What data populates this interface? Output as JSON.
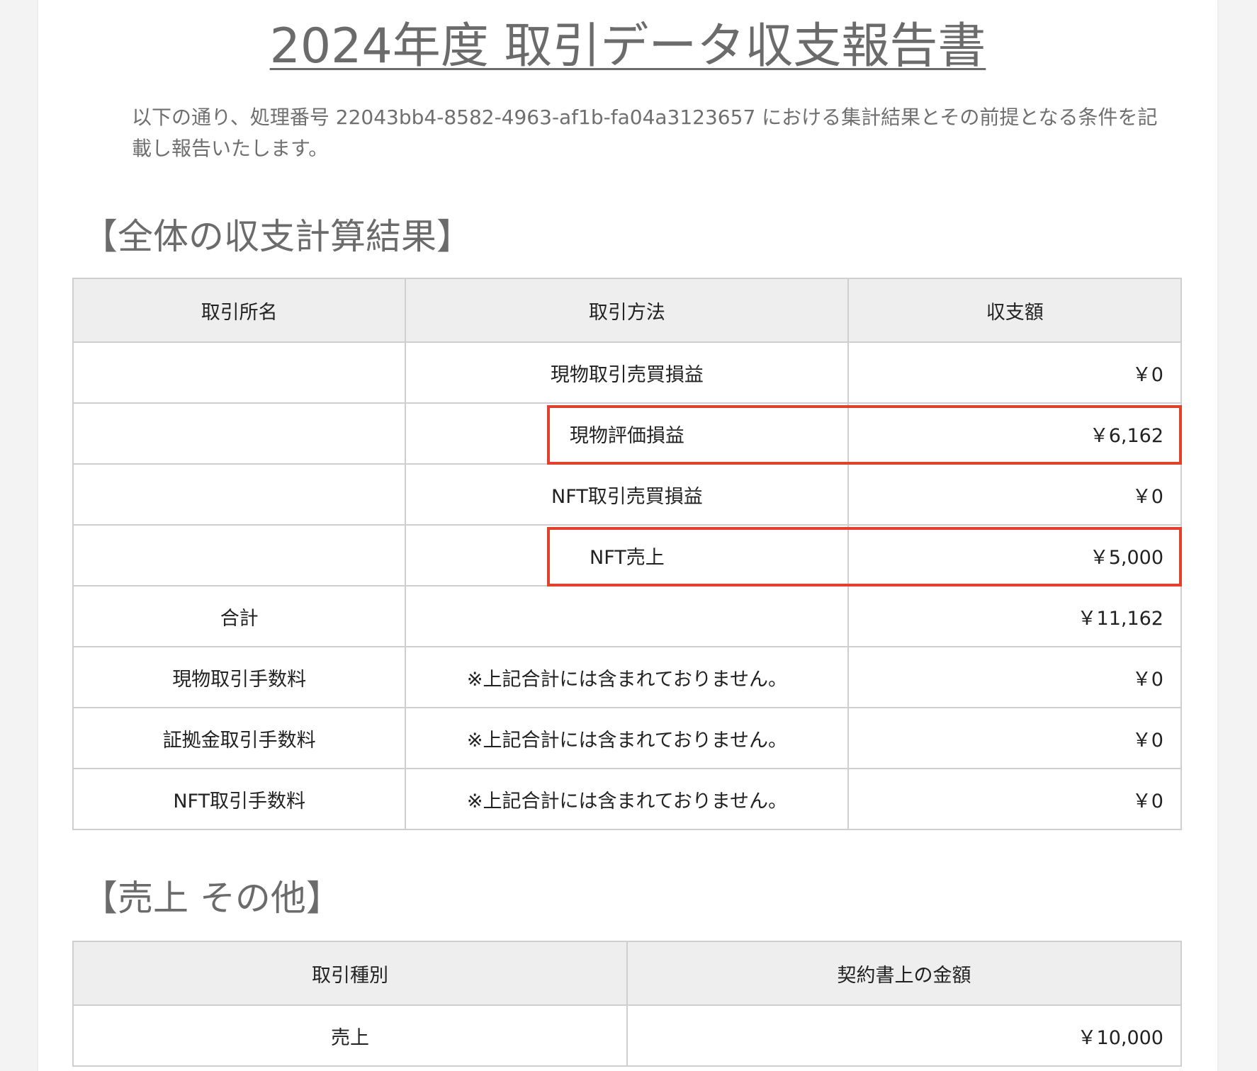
{
  "document": {
    "title": "2024年度 取引データ収支報告書",
    "intro": "以下の通り、処理番号 22043bb4-8582-4963-af1b-fa04a3123657 における集計結果とその前提となる条件を記載し報告いたします。"
  },
  "section1": {
    "heading": "【全体の収支計算結果】",
    "headers": [
      "取引所名",
      "取引方法",
      "収支額"
    ],
    "rows": [
      {
        "exchange": "",
        "method": "現物取引売買損益",
        "amount": "￥0"
      },
      {
        "exchange": "",
        "method": "現物評価損益",
        "amount": "￥6,162"
      },
      {
        "exchange": "",
        "method": "NFT取引売買損益",
        "amount": "￥0"
      },
      {
        "exchange": "",
        "method": "NFT売上",
        "amount": "￥5,000"
      },
      {
        "exchange": "合計",
        "method": "",
        "amount": "￥11,162"
      },
      {
        "exchange": "現物取引手数料",
        "method": "※上記合計には含まれておりません。",
        "amount": "￥0"
      },
      {
        "exchange": "証拠金取引手数料",
        "method": "※上記合計には含まれておりません。",
        "amount": "￥0"
      },
      {
        "exchange": "NFT取引手数料",
        "method": "※上記合計には含まれておりません。",
        "amount": "￥0"
      }
    ]
  },
  "section2": {
    "heading": "【売上 その他】",
    "headers": [
      "取引種別",
      "契約書上の金額"
    ],
    "rows": [
      {
        "type": "売上",
        "amount": "￥10,000"
      }
    ]
  },
  "colors": {
    "highlight": "#e2412e",
    "header_bg": "#eeeeee",
    "border": "#cfcfcf"
  }
}
